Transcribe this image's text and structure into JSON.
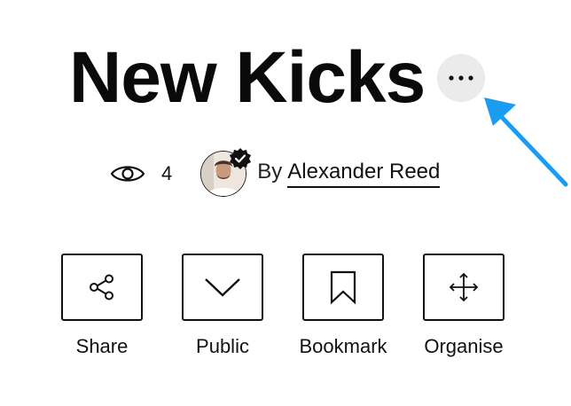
{
  "header": {
    "title": "New Kicks",
    "more_icon": "more-horizontal-icon"
  },
  "meta": {
    "views_icon": "eye-icon",
    "views_count": "4",
    "avatar_icon": "avatar",
    "verified_icon": "verified-badge-icon",
    "by_label": "By",
    "author_name": "Alexander Reed"
  },
  "actions": [
    {
      "label": "Share",
      "icon": "share-icon"
    },
    {
      "label": "Public",
      "icon": "chevron-down-icon"
    },
    {
      "label": "Bookmark",
      "icon": "bookmark-icon"
    },
    {
      "label": "Organise",
      "icon": "move-icon"
    }
  ],
  "colors": {
    "accent_arrow": "#1a9cf0",
    "more_button_bg": "#ebebeb",
    "text": "#111111"
  }
}
